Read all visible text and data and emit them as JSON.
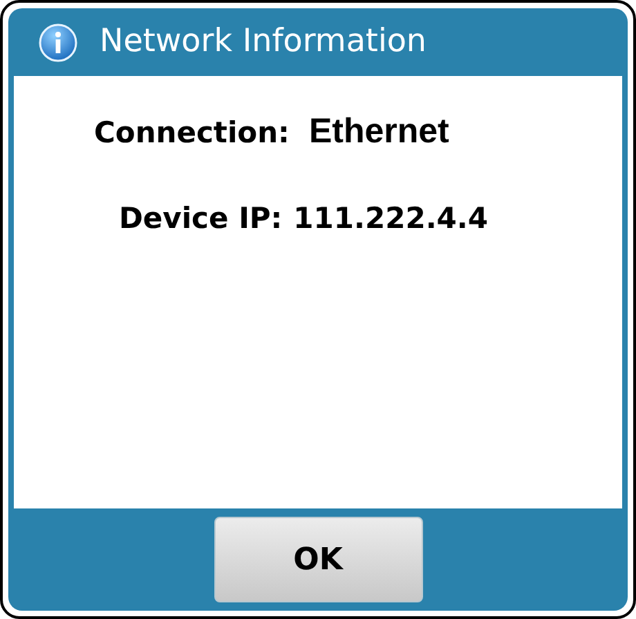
{
  "window": {
    "title": "Network Information"
  },
  "fields": [
    {
      "label": "Connection:",
      "value": "Ethernet"
    },
    {
      "label": "Device IP:",
      "value": "111.222.4.4"
    }
  ],
  "buttons": [
    "OK"
  ]
}
